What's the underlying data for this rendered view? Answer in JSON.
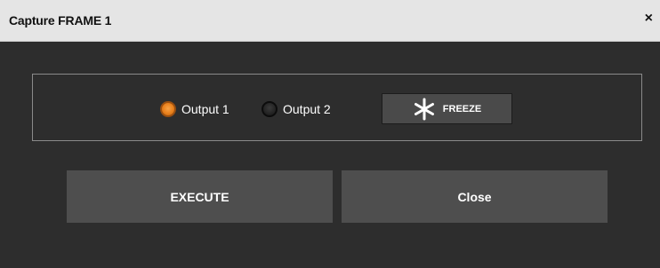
{
  "dialog": {
    "title": "Capture FRAME 1",
    "close_glyph": "×"
  },
  "output_selection": {
    "options": [
      {
        "label": "Output 1",
        "selected": true
      },
      {
        "label": "Output 2",
        "selected": false
      }
    ],
    "freeze_button": {
      "label": "FREEZE",
      "icon": "snowflake-icon"
    }
  },
  "actions": {
    "execute_label": "EXECUTE",
    "close_label": "Close"
  },
  "colors": {
    "dialog_background": "#2d2d2d",
    "titlebar_background": "#e5e5e5",
    "button_background": "#4e4e4e",
    "radio_selected": "#e8801c"
  }
}
